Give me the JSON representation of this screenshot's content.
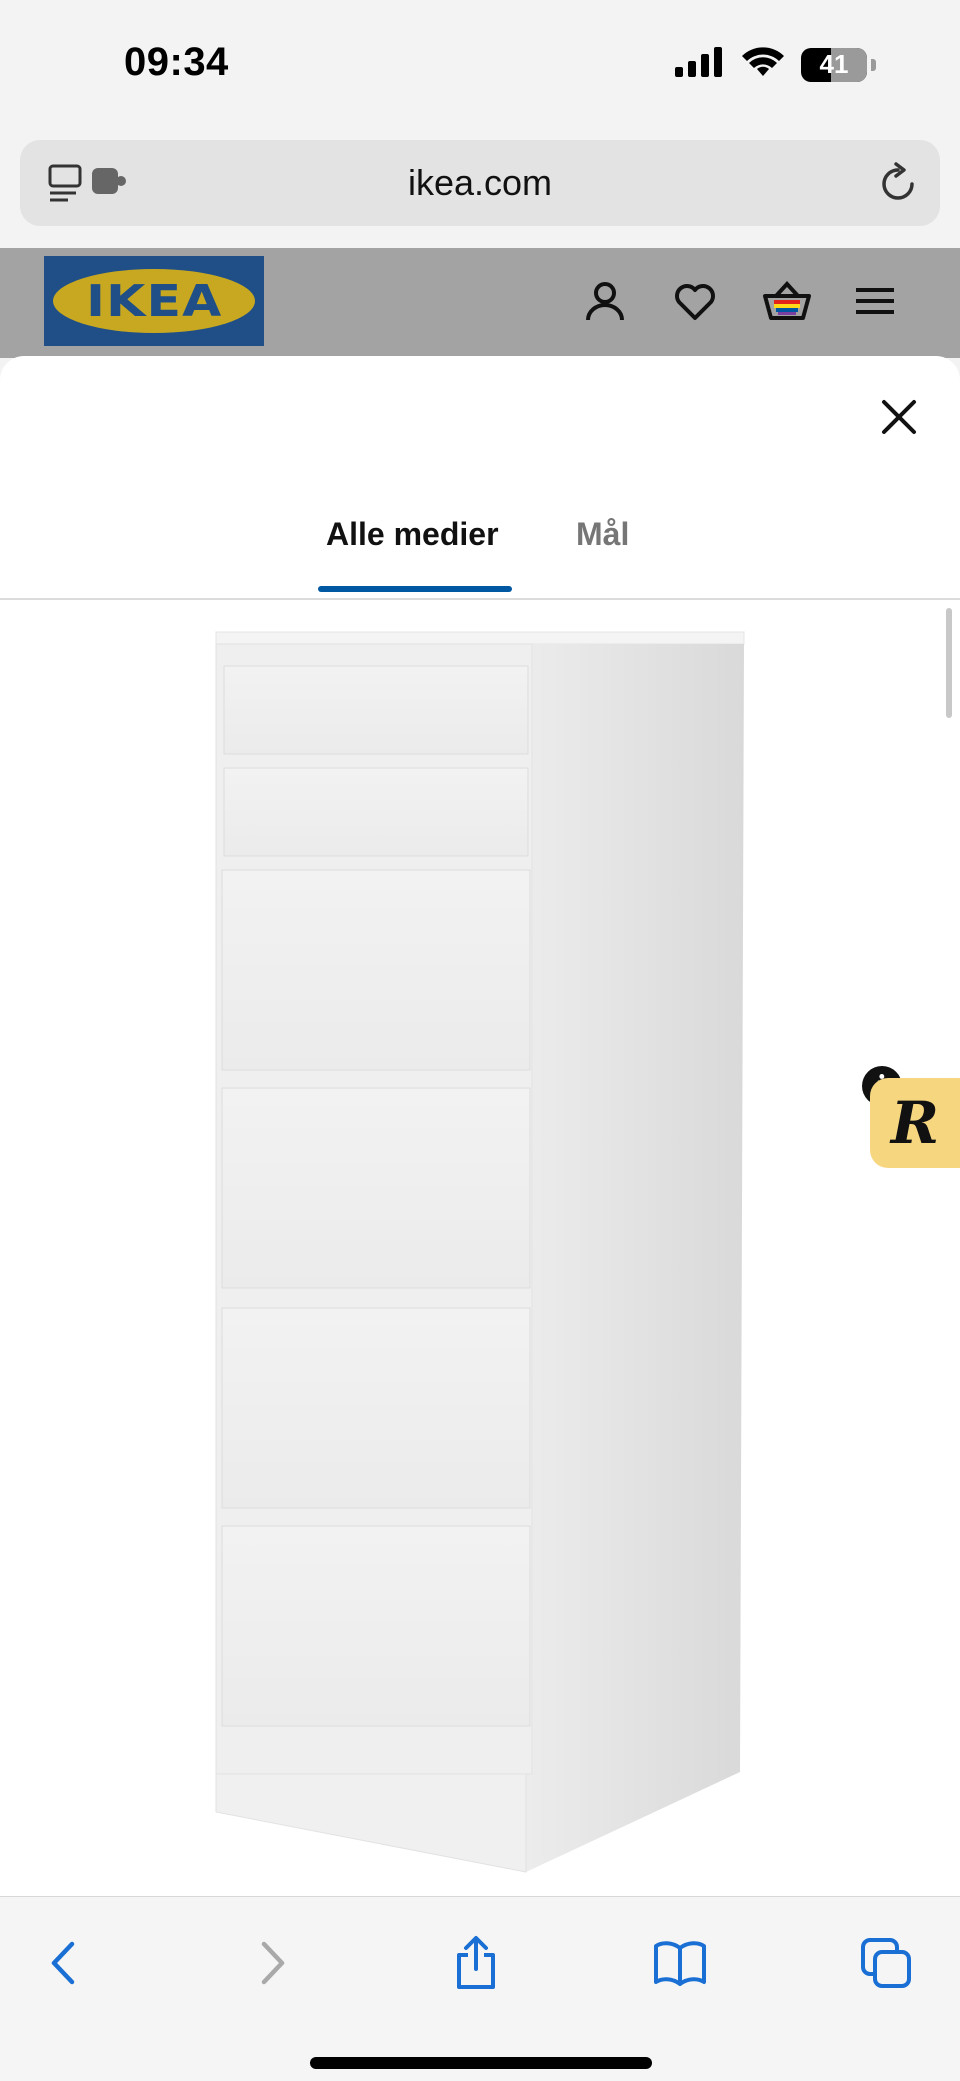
{
  "status_bar": {
    "time": "09:34",
    "battery": "41",
    "icons": [
      "cellular-signal-icon",
      "wifi-icon",
      "battery-icon"
    ]
  },
  "browser": {
    "url": "ikea.com",
    "icons": [
      "tabs-extension-icon",
      "reload-icon"
    ]
  },
  "site_header": {
    "logo_text": "IKEA",
    "brand_colors": {
      "blue": "#1f4f86",
      "yellow": "#c8a820"
    },
    "icons": [
      "account-icon",
      "wishlist-heart-icon",
      "shopping-bag-icon",
      "menu-icon"
    ]
  },
  "media_modal": {
    "tabs": [
      {
        "label": "Alle medier",
        "selected": true
      },
      {
        "label": "Mål",
        "selected": false
      }
    ],
    "accent_color": "#0058a3",
    "close_icon": "close-icon",
    "product_image": "white-chest-of-drawers"
  },
  "floating_badge": {
    "letter": "R",
    "info_letter": "i"
  },
  "toolbar": {
    "icons": [
      "back-icon",
      "forward-icon",
      "share-icon",
      "bookmarks-icon",
      "tabs-icon"
    ]
  }
}
